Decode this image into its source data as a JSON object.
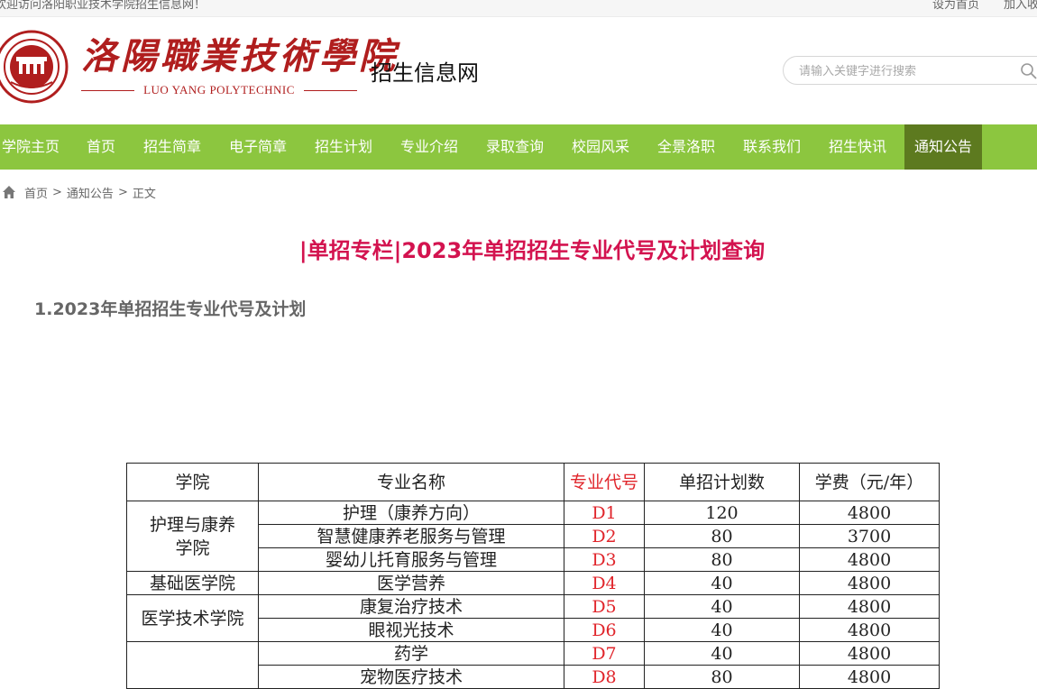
{
  "topbar": {
    "welcome": "欢迎访问洛阳职业技术学院招生信息网！",
    "set_home": "设为首页",
    "add_favorite": "加入收藏"
  },
  "header": {
    "logo_cn": "洛陽職業技術學院",
    "logo_en": "LUO YANG POLYTECHNIC",
    "emblem_ring_text": "洛阳职业技术学院",
    "emblem_bottom_text": "luoyang polytechnic",
    "site_name": "招生信息网",
    "search_placeholder": "请输入关键字进行搜索"
  },
  "nav": {
    "items": [
      {
        "label": "学院主页"
      },
      {
        "label": "首页"
      },
      {
        "label": "招生简章"
      },
      {
        "label": "电子简章"
      },
      {
        "label": "招生计划"
      },
      {
        "label": "专业介绍"
      },
      {
        "label": "录取查询"
      },
      {
        "label": "校园风采"
      },
      {
        "label": "全景洛职"
      },
      {
        "label": "联系我们"
      },
      {
        "label": "招生快讯"
      },
      {
        "label": "通知公告",
        "active": true
      }
    ]
  },
  "breadcrumb": {
    "home": "首页",
    "section": "通知公告",
    "current": "正文",
    "separator": ">"
  },
  "article": {
    "title": "|单招专栏|2023年单招招生专业代号及计划查询",
    "section_heading": "1.2023年单招招生专业代号及计划"
  },
  "table": {
    "headers": [
      "学院",
      "专业名称",
      "专业代号",
      "单招计划数",
      "学费（元/年）"
    ],
    "groups": [
      {
        "college": "护理与康养学院",
        "rows": [
          {
            "major": "护理（康养方向）",
            "code": "D1",
            "plan": "120",
            "fee": "4800"
          },
          {
            "major": "智慧健康养老服务与管理",
            "code": "D2",
            "plan": "80",
            "fee": "3700"
          },
          {
            "major": "婴幼儿托育服务与管理",
            "code": "D3",
            "plan": "80",
            "fee": "4800"
          }
        ]
      },
      {
        "college": "基础医学院",
        "rows": [
          {
            "major": "医学营养",
            "code": "D4",
            "plan": "40",
            "fee": "4800"
          }
        ]
      },
      {
        "college": "医学技术学院",
        "rows": [
          {
            "major": "康复治疗技术",
            "code": "D5",
            "plan": "40",
            "fee": "4800"
          },
          {
            "major": "眼视光技术",
            "code": "D6",
            "plan": "40",
            "fee": "4800"
          }
        ]
      },
      {
        "college": "",
        "rows": [
          {
            "major": "药学",
            "code": "D7",
            "plan": "40",
            "fee": "4800"
          },
          {
            "major": "宠物医疗技术",
            "code": "D8",
            "plan": "80",
            "fee": "4800"
          }
        ]
      }
    ]
  },
  "colors": {
    "nav_green": "#8cc63f",
    "nav_active": "#5d7a1f",
    "title_red": "#d3134f",
    "logo_red": "#b01e1e",
    "code_red": "#e0252b"
  },
  "icons": {
    "search": "search-icon",
    "home": "home-icon",
    "emblem": "college-emblem"
  }
}
